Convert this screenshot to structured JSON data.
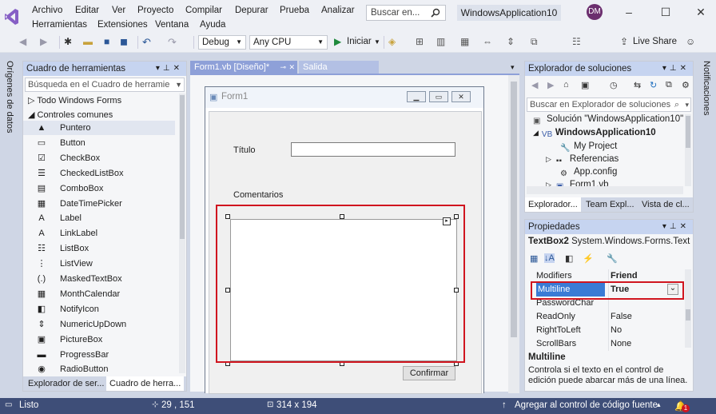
{
  "menu": {
    "row1": [
      "Archivo",
      "Editar",
      "Ver",
      "Proyecto",
      "Compilar",
      "Depurar",
      "Prueba",
      "Analizar"
    ],
    "row2": [
      "Herramientas",
      "Extensiones",
      "Ventana",
      "Ayuda"
    ],
    "search_placeholder": "Buscar en...",
    "project_title": "WindowsApplication10",
    "avatar_initials": "DM"
  },
  "toolbar": {
    "config": "Debug",
    "platform": "Any CPU",
    "start_label": "Iniciar",
    "live_share": "Live Share"
  },
  "side_tabs": {
    "left": "Orígenes de datos",
    "right": "Notificaciones"
  },
  "toolbox": {
    "title": "Cuadro de herramientas",
    "search_placeholder": "Búsqueda en el Cuadro de herramie",
    "group_all": "Todo Windows Forms",
    "group_common": "Controles comunes",
    "items": [
      {
        "label": "Puntero",
        "icon": "▲"
      },
      {
        "label": "Button",
        "icon": "▭"
      },
      {
        "label": "CheckBox",
        "icon": "☑"
      },
      {
        "label": "CheckedListBox",
        "icon": "☰"
      },
      {
        "label": "ComboBox",
        "icon": "▤"
      },
      {
        "label": "DateTimePicker",
        "icon": "▦"
      },
      {
        "label": "Label",
        "icon": "A"
      },
      {
        "label": "LinkLabel",
        "icon": "A"
      },
      {
        "label": "ListBox",
        "icon": "☷"
      },
      {
        "label": "ListView",
        "icon": "⋮"
      },
      {
        "label": "MaskedTextBox",
        "icon": "(.)"
      },
      {
        "label": "MonthCalendar",
        "icon": "▦"
      },
      {
        "label": "NotifyIcon",
        "icon": "◧"
      },
      {
        "label": "NumericUpDown",
        "icon": "⇕"
      },
      {
        "label": "PictureBox",
        "icon": "▣"
      },
      {
        "label": "ProgressBar",
        "icon": "▬"
      },
      {
        "label": "RadioButton",
        "icon": "◉"
      }
    ],
    "bottom_tabs": [
      "Explorador de ser...",
      "Cuadro de herra..."
    ]
  },
  "doc_tabs": {
    "designer": "Form1.vb [Diseño]*",
    "output": "Salida"
  },
  "form": {
    "title": "Form1",
    "label_titulo": "Título",
    "label_comentarios": "Comentarios",
    "confirm_button": "Confirmar"
  },
  "solution_explorer": {
    "title": "Explorador de soluciones",
    "search_placeholder": "Buscar en Explorador de soluciones (",
    "solution": "Solución \"WindowsApplication10\"",
    "project": "WindowsApplication10",
    "items": [
      "My Project",
      "Referencias",
      "App.config",
      "Form1.vb"
    ],
    "tabs": [
      "Explorador...",
      "Team Expl...",
      "Vista de cl..."
    ]
  },
  "properties": {
    "title": "Propiedades",
    "object_name": "TextBox2",
    "object_type": "System.Windows.Forms.Text",
    "rows": [
      {
        "name": "Modifiers",
        "value": "Friend"
      },
      {
        "name": "Multiline",
        "value": "True"
      },
      {
        "name": "PasswordChar",
        "value": ""
      },
      {
        "name": "ReadOnly",
        "value": "False"
      },
      {
        "name": "RightToLeft",
        "value": "No"
      },
      {
        "name": "ScrollBars",
        "value": "None"
      }
    ],
    "desc_title": "Multiline",
    "desc_text": "Controla si el texto en el control de edición puede abarcar más de una línea."
  },
  "status": {
    "ready": "Listo",
    "position": "29 , 151",
    "size": "314 x 194",
    "source_control": "Agregar al control de código fuente",
    "notification_count": "1"
  },
  "colors": {
    "accent": "#3a7bd5",
    "highlight_red": "#d0151f",
    "status_bar": "#3e4e78"
  }
}
